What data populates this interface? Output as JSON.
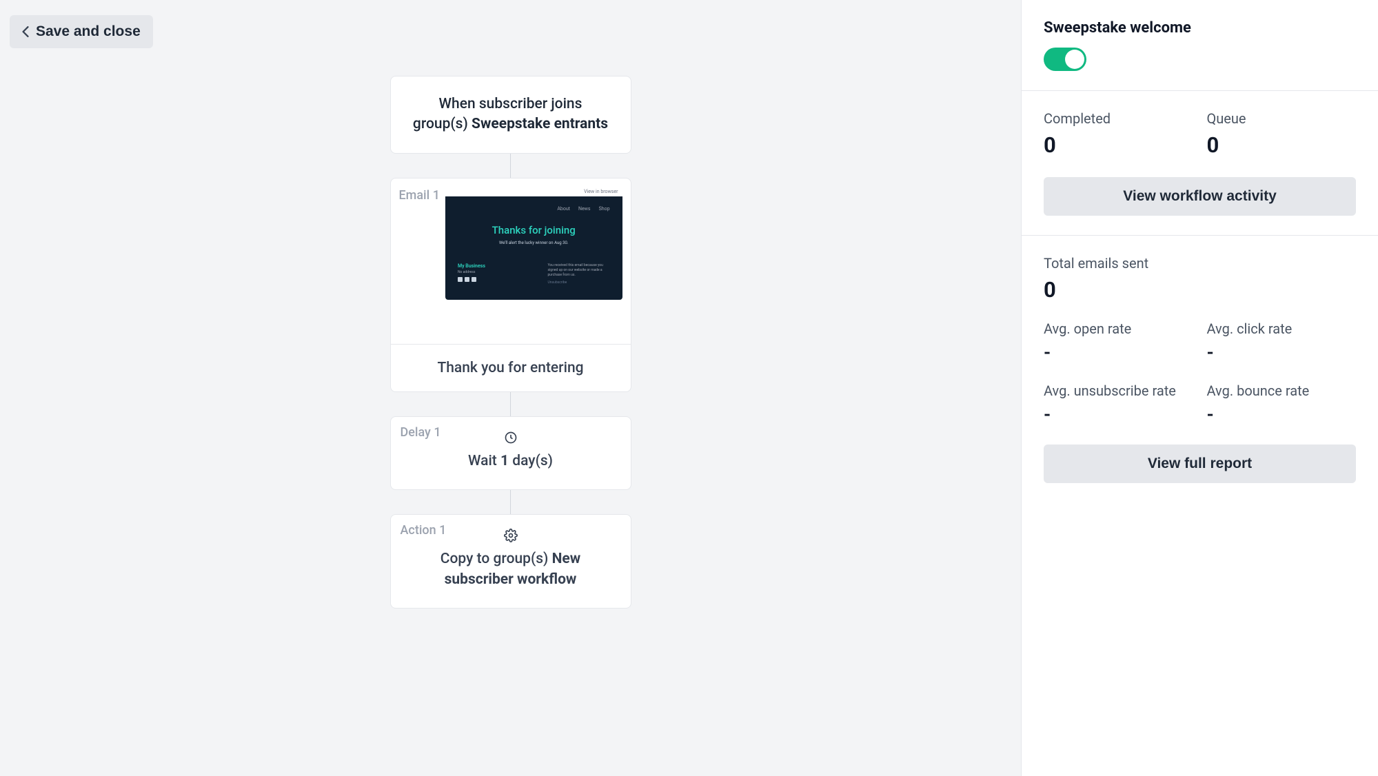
{
  "header": {
    "save_close_label": "Save and close"
  },
  "workflow": {
    "trigger": {
      "prefix": "When subscriber joins group(s) ",
      "group_name": "Sweepstake entrants"
    },
    "email": {
      "label": "Email 1",
      "preview": {
        "view_browser": "View in browser",
        "nav": [
          "About",
          "News",
          "Shop"
        ],
        "title": "Thanks for joining",
        "subtitle": "We'll alert the lucky winner on Aug 30.",
        "brand": "My Business",
        "address": "No address",
        "disclaimer": "You received this email because you signed up on our website or made a purchase from us.",
        "unsubscribe": "Unsubscribe"
      },
      "caption": "Thank you for entering"
    },
    "delay": {
      "label": "Delay 1",
      "prefix": "Wait ",
      "count": "1",
      "suffix": " day(s)"
    },
    "action": {
      "label": "Action 1",
      "prefix": "Copy to group(s) ",
      "group_name": "New subscriber workflow"
    }
  },
  "sidebar": {
    "title": "Sweepstake welcome",
    "toggle_on": true,
    "stats_top": {
      "completed": {
        "label": "Completed",
        "value": "0"
      },
      "queue": {
        "label": "Queue",
        "value": "0"
      }
    },
    "view_activity_label": "View workflow activity",
    "total_emails": {
      "label": "Total emails sent",
      "value": "0"
    },
    "rates": {
      "open": {
        "label": "Avg. open rate",
        "value": "-"
      },
      "click": {
        "label": "Avg. click rate",
        "value": "-"
      },
      "unsub": {
        "label": "Avg. unsubscribe rate",
        "value": "-"
      },
      "bounce": {
        "label": "Avg. bounce rate",
        "value": "-"
      }
    },
    "view_report_label": "View full report"
  }
}
